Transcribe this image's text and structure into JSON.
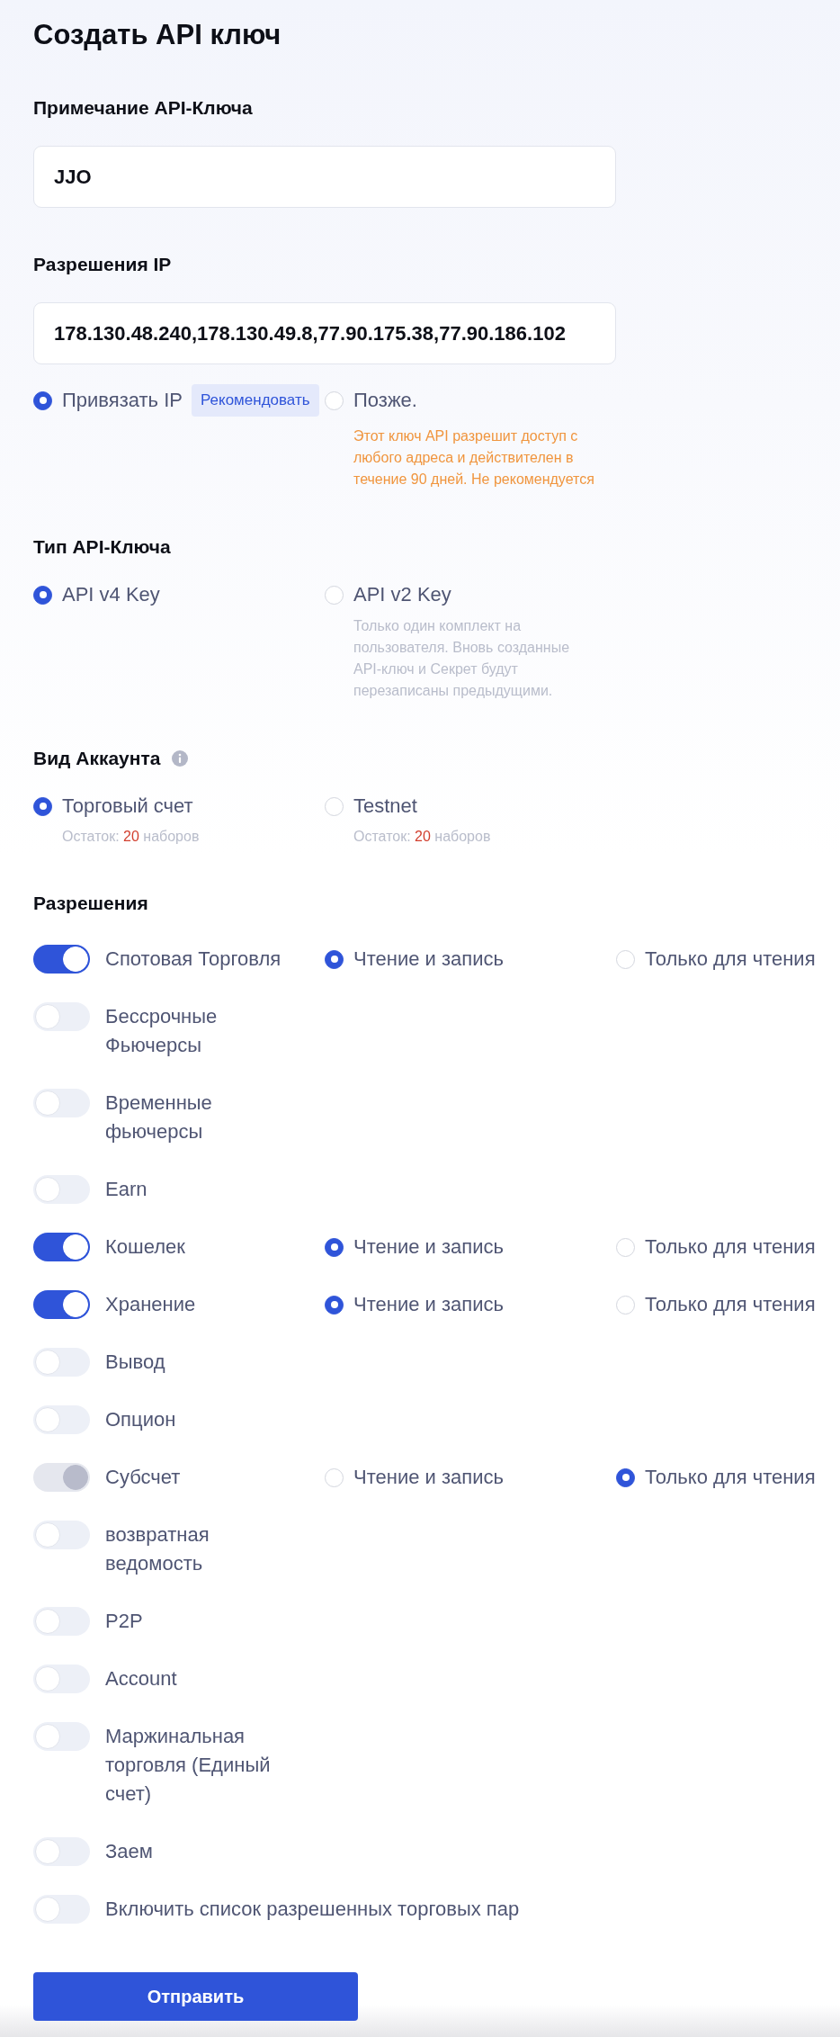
{
  "page": {
    "title": "Создать API ключ"
  },
  "api_key_note": {
    "label": "Примечание API-Ключа",
    "value": "JJO"
  },
  "ip_permissions": {
    "label": "Разрешения IP",
    "value": "178.130.48.240,178.130.49.8,77.90.175.38,77.90.186.102",
    "options": [
      {
        "label": "Привязать IP",
        "selected": true,
        "badge": "Рекомендовать"
      },
      {
        "label": "Позже.",
        "selected": false,
        "warning": "Этот ключ API разрешит доступ с любого адреса и действителен в течение 90 дней. Не рекомендуется"
      }
    ]
  },
  "api_key_type": {
    "label": "Тип API-Ключа",
    "options": [
      {
        "label": "API v4 Key",
        "selected": true
      },
      {
        "label": "API v2 Key",
        "selected": false,
        "note": "Только один комплект на пользователя. Вновь созданные API-ключ и Секрет будут перезаписаны предыдущими."
      }
    ]
  },
  "account_type": {
    "label": "Вид Аккаунта",
    "options": [
      {
        "label": "Торговый счет",
        "selected": true,
        "remaining": {
          "prefix": "Остаток:",
          "count": "20",
          "suffix": "наборов"
        }
      },
      {
        "label": "Testnet",
        "selected": false,
        "remaining": {
          "prefix": "Остаток:",
          "count": "20",
          "suffix": "наборов"
        }
      }
    ]
  },
  "permissions": {
    "label": "Разрешения",
    "items": [
      {
        "label": "Спотовая Торговля",
        "on": true,
        "disabled": false,
        "options": [
          {
            "label": "Чтение и запись",
            "selected": true
          },
          {
            "label": "Только для чтения",
            "selected": false
          }
        ]
      },
      {
        "label": "Бессрочные Фьючерсы",
        "on": false,
        "disabled": false
      },
      {
        "label": "Временные фьючерсы",
        "on": false,
        "disabled": false
      },
      {
        "label": "Earn",
        "on": false,
        "disabled": false
      },
      {
        "label": "Кошелек",
        "on": true,
        "disabled": false,
        "options": [
          {
            "label": "Чтение и запись",
            "selected": true
          },
          {
            "label": "Только для чтения",
            "selected": false
          }
        ]
      },
      {
        "label": "Хранение",
        "on": true,
        "disabled": false,
        "options": [
          {
            "label": "Чтение и запись",
            "selected": true
          },
          {
            "label": "Только для чтения",
            "selected": false
          }
        ]
      },
      {
        "label": "Вывод",
        "on": false,
        "disabled": false
      },
      {
        "label": "Опцион",
        "on": false,
        "disabled": false
      },
      {
        "label": "Субсчет",
        "on": true,
        "disabled": true,
        "options": [
          {
            "label": "Чтение и запись",
            "selected": false
          },
          {
            "label": "Только для чтения",
            "selected": true
          }
        ]
      },
      {
        "label": "возвратная ведомость",
        "on": false,
        "disabled": false
      },
      {
        "label": "P2P",
        "on": false,
        "disabled": false
      },
      {
        "label": "Account",
        "on": false,
        "disabled": false
      },
      {
        "label": "Маржинальная торговля (Единый счет)",
        "on": false,
        "disabled": false
      },
      {
        "label": "Заем",
        "on": false,
        "disabled": false
      }
    ]
  },
  "pair_whitelist": {
    "label": "Включить список разрешенных торговых пар",
    "on": false
  },
  "submit_button": {
    "label": "Отправить"
  }
}
